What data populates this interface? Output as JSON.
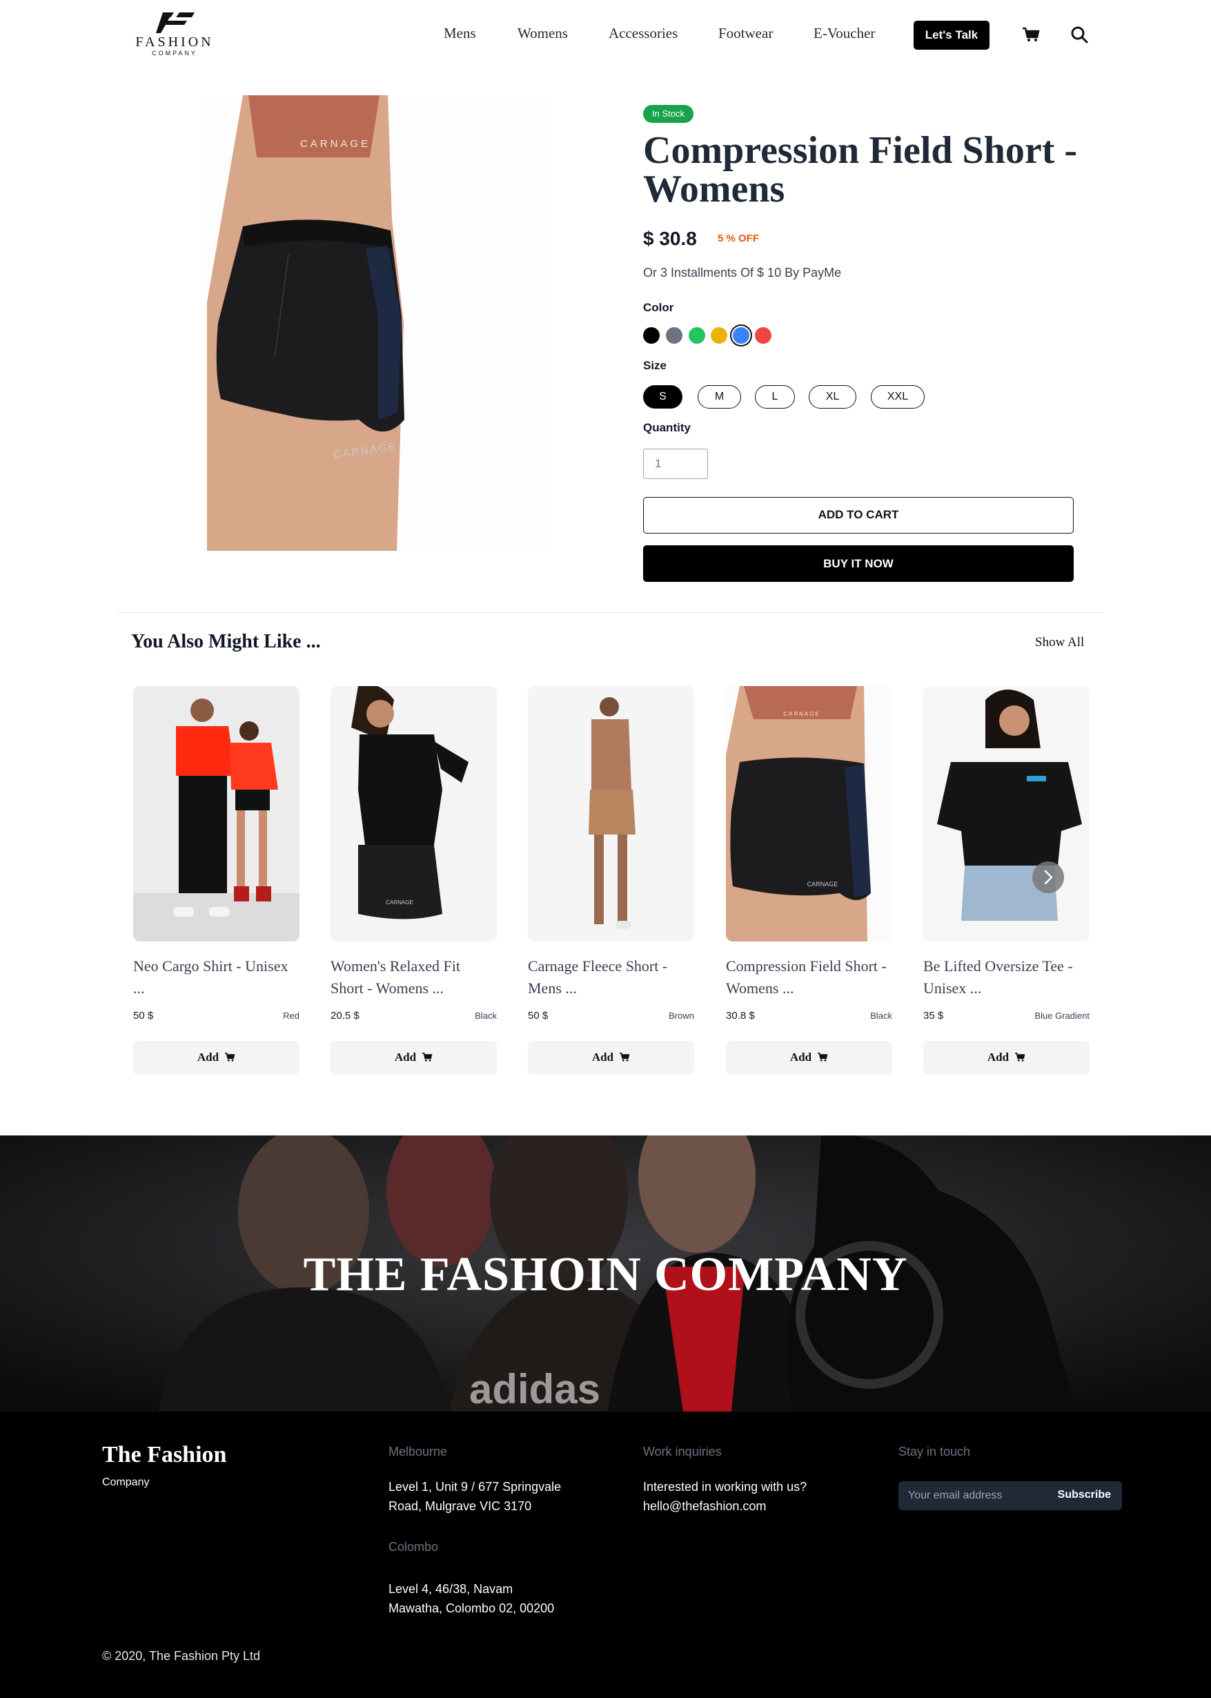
{
  "header": {
    "brand_word": "FASHION",
    "brand_sub": "COMPANY",
    "nav": [
      "Mens",
      "Womens",
      "Accessories",
      "Footwear",
      "E-Voucher"
    ],
    "cta_label": "Let's Talk",
    "cart_icon": "cart-icon",
    "search_icon": "search-icon"
  },
  "product": {
    "stock_badge": "In Stock",
    "title": "Compression Field Short - Womens",
    "price": "$ 30.8",
    "discount": "5 % OFF",
    "installment": "Or 3 Installments Of $ 10 By PayMe",
    "image_text_top": "CARNAGE",
    "image_text_bottom": "CARNAGE",
    "color_label": "Color",
    "colors": [
      "#000000",
      "#6b7280",
      "#22c55e",
      "#eab308",
      "#3b82f6",
      "#ef4444"
    ],
    "selected_color": "#3b82f6",
    "size_label": "Size",
    "sizes": [
      "S",
      "M",
      "L",
      "XL",
      "XXL"
    ],
    "selected_size": "S",
    "quantity_label": "Quantity",
    "quantity_placeholder": "1",
    "add_to_cart": "ADD TO CART",
    "buy_now": "BUY IT NOW"
  },
  "related": {
    "title": "You Also Might Like ...",
    "show_all": "Show All",
    "add_label": "Add",
    "items": [
      {
        "name": "Neo Cargo Shirt - Unisex ...",
        "price": "50 $",
        "color": "Red"
      },
      {
        "name": "Women's Relaxed Fit Short - Womens ...",
        "price": "20.5 $",
        "color": "Black"
      },
      {
        "name": "Carnage Fleece Short - Mens ...",
        "price": "50 $",
        "color": "Brown"
      },
      {
        "name": "Compression Field Short - Womens ...",
        "price": "30.8 $",
        "color": "Black"
      },
      {
        "name": "Be Lifted Oversize Tee - Unisex ...",
        "price": "35 $",
        "color": "Blue Gradient"
      }
    ]
  },
  "banner": {
    "title": "THE FASHOIN COMPANY",
    "image_text": "adidas"
  },
  "footer": {
    "brand": "The Fashion",
    "brand_sub": "Company",
    "melbourne_heading": "Melbourne",
    "melbourne_line1": "Level 1, Unit 9 / 677 Springvale",
    "melbourne_line2": "Road, Mulgrave VIC 3170",
    "colombo_heading": "Colombo",
    "colombo_line1": "Level 4, 46/38, Navam",
    "colombo_line2": "Mawatha, Colombo 02, 00200",
    "work_heading": "Work inquiries",
    "work_line1": "Interested in working with us?",
    "work_email": "hello@thefashion.com",
    "stay_heading": "Stay in touch",
    "email_placeholder": "Your email address",
    "subscribe": "Subscribe",
    "copyright": "© 2020, The Fashion Pty Ltd"
  }
}
